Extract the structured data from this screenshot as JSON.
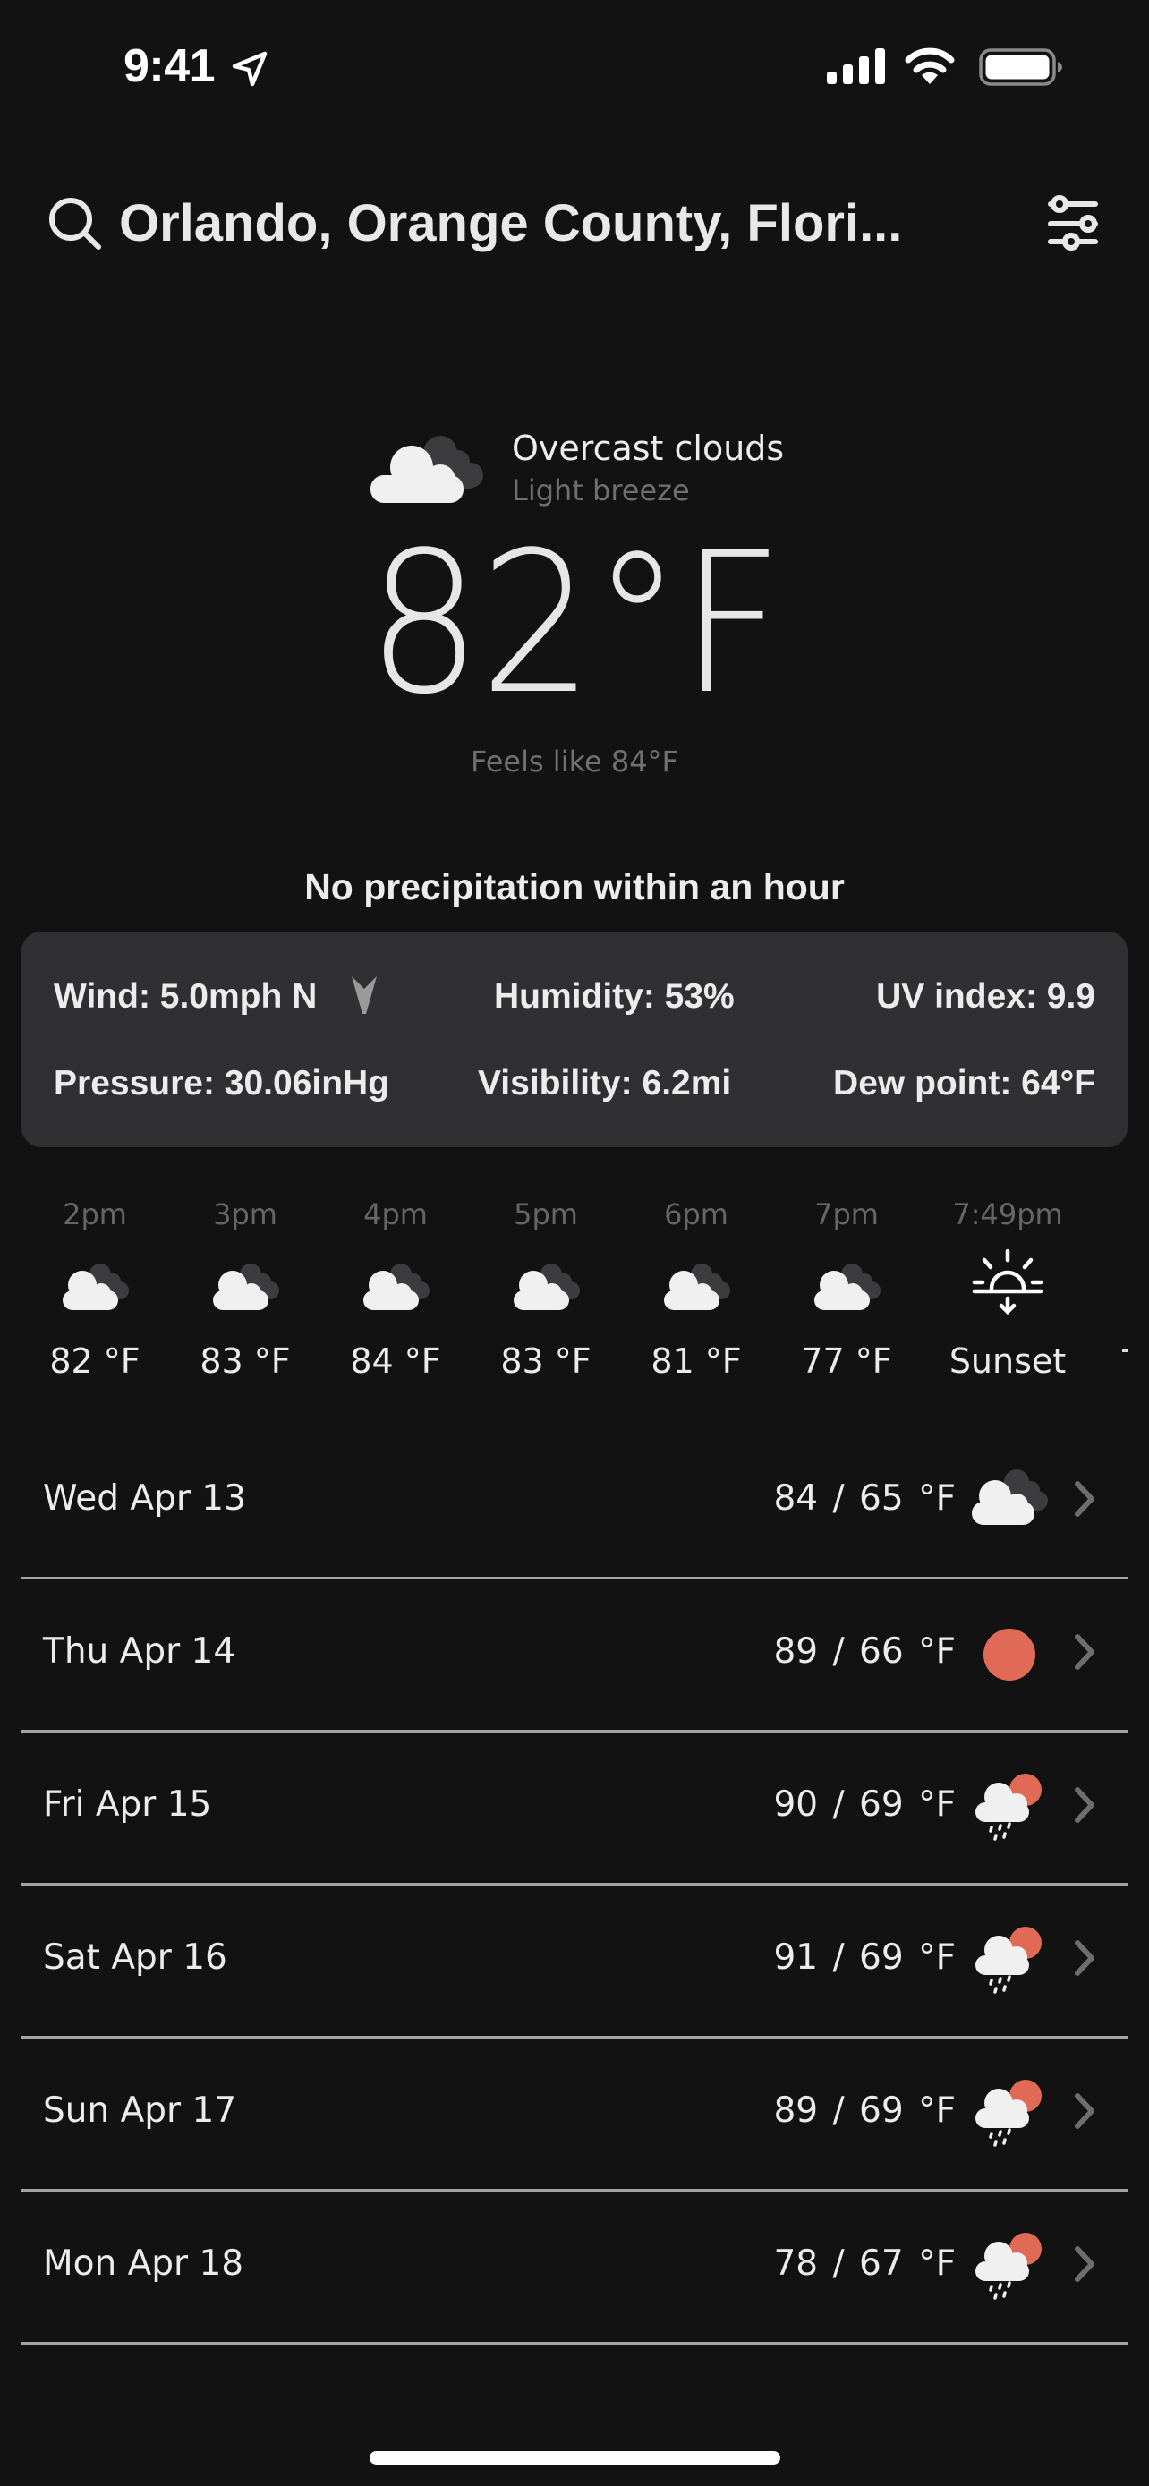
{
  "status_bar": {
    "time": "9:41",
    "location_icon": "location-arrow-icon",
    "signal_icon": "cellular-signal-icon",
    "wifi_icon": "wifi-icon",
    "battery_icon": "battery-full-icon"
  },
  "header": {
    "search_icon": "search-icon",
    "location": "Orlando, Orange County, Flori...",
    "filter_icon": "sliders-icon"
  },
  "current": {
    "icon": "overcast-clouds-icon",
    "condition": "Overcast clouds",
    "wind_desc": "Light breeze",
    "temperature": "82°F",
    "feels_like": "Feels like 84°F",
    "precipitation": "No precipitation within an hour"
  },
  "stats": {
    "wind": "Wind: 5.0mph N",
    "wind_direction_icon": "wind-direction-arrow-icon",
    "humidity": "Humidity: 53%",
    "uv_index": "UV index: 9.9",
    "pressure": "Pressure: 30.06inHg",
    "visibility": "Visibility: 6.2mi",
    "dew_point": "Dew point: 64°F"
  },
  "hourly": [
    {
      "time": "2pm",
      "icon": "overcast-clouds-icon",
      "temp": "82 °F"
    },
    {
      "time": "3pm",
      "icon": "overcast-clouds-icon",
      "temp": "83 °F"
    },
    {
      "time": "4pm",
      "icon": "overcast-clouds-icon",
      "temp": "84 °F"
    },
    {
      "time": "5pm",
      "icon": "overcast-clouds-icon",
      "temp": "83 °F"
    },
    {
      "time": "6pm",
      "icon": "overcast-clouds-icon",
      "temp": "81 °F"
    },
    {
      "time": "7pm",
      "icon": "overcast-clouds-icon",
      "temp": "77 °F"
    },
    {
      "time": "7:49pm",
      "icon": "sunset-icon",
      "temp": "Sunset"
    }
  ],
  "daily": [
    {
      "day": "Wed Apr 13",
      "temps": "84 / 65 °F",
      "icon": "overcast-clouds-icon"
    },
    {
      "day": "Thu Apr 14",
      "temps": "89 / 66 °F",
      "icon": "sun-icon"
    },
    {
      "day": "Fri Apr 15",
      "temps": "90 / 69 °F",
      "icon": "rain-sun-icon"
    },
    {
      "day": "Sat Apr 16",
      "temps": "91 / 69 °F",
      "icon": "rain-sun-icon"
    },
    {
      "day": "Sun Apr 17",
      "temps": "89 / 69 °F",
      "icon": "rain-sun-icon"
    },
    {
      "day": "Mon Apr 18",
      "temps": "78 / 67 °F",
      "icon": "rain-sun-icon"
    }
  ],
  "colors": {
    "background": "#121212",
    "card": "#303032",
    "sun": "#E06A55",
    "muted_text": "#6f6f6f"
  }
}
